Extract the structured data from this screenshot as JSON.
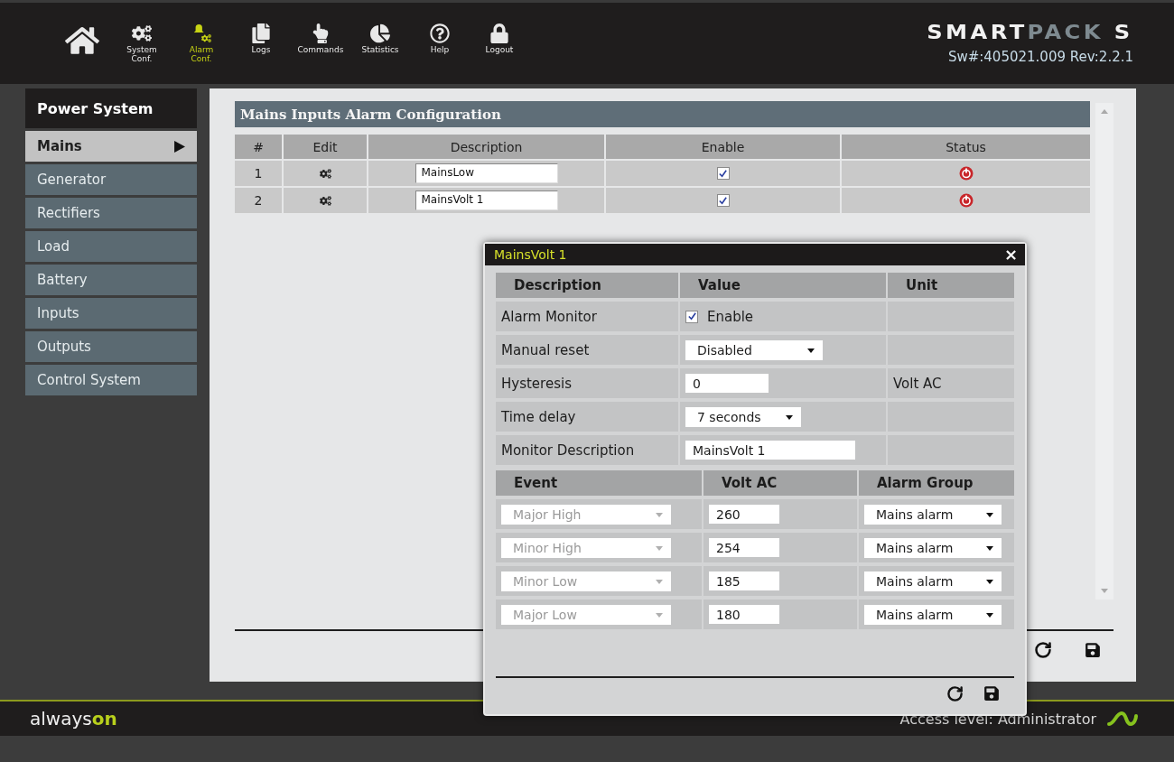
{
  "nav": {
    "items": [
      {
        "kind": "home",
        "selected": false
      },
      {
        "kind": "system",
        "label": "System\nConf.",
        "selected": false
      },
      {
        "kind": "alarm",
        "label": "Alarm\nConf.",
        "selected": true
      },
      {
        "kind": "logs",
        "label": "Logs",
        "selected": false
      },
      {
        "kind": "commands",
        "label": "Commands",
        "selected": false
      },
      {
        "kind": "statistics",
        "label": "Statistics",
        "selected": false
      },
      {
        "kind": "help",
        "label": "Help",
        "selected": false
      },
      {
        "kind": "logout",
        "label": "Logout",
        "selected": false
      }
    ]
  },
  "brand": {
    "logo": [
      {
        "text": "SMART",
        "dim": false
      },
      {
        "text": "PACK",
        "dim": true
      },
      {
        "text": " S",
        "dim": false
      }
    ],
    "version": "Sw#:405021.009 Rev:2.2.1"
  },
  "sidebar": {
    "title": "Power System",
    "items": [
      {
        "label": "Mains",
        "selected": true
      },
      {
        "label": "Generator",
        "selected": false
      },
      {
        "label": "Rectifiers",
        "selected": false
      },
      {
        "label": "Load",
        "selected": false
      },
      {
        "label": "Battery",
        "selected": false
      },
      {
        "label": "Inputs",
        "selected": false
      },
      {
        "label": "Outputs",
        "selected": false
      },
      {
        "label": "Control System",
        "selected": false
      }
    ]
  },
  "panel": {
    "title": "Mains Inputs Alarm Configuration",
    "columns": [
      "#",
      "Edit",
      "Description",
      "Enable",
      "Status"
    ],
    "rows": [
      {
        "index": "1",
        "description": "MainsLow",
        "enabled": true,
        "alarm": true
      },
      {
        "index": "2",
        "description": "MainsVolt 1",
        "enabled": true,
        "alarm": true
      }
    ]
  },
  "dialog": {
    "title": "MainsVolt 1",
    "close": "×",
    "columns": [
      "Description",
      "Value",
      "Unit"
    ],
    "rows": [
      {
        "label": "Alarm Monitor",
        "kind": "checkbox",
        "checked": true,
        "value": "Enable"
      },
      {
        "label": "Manual reset",
        "kind": "select",
        "value": "Disabled"
      },
      {
        "label": "Hysteresis",
        "kind": "input",
        "value": "0",
        "unit": "Volt AC"
      },
      {
        "label": "Time delay",
        "kind": "select",
        "value": "7 seconds"
      },
      {
        "label": "Monitor Description",
        "kind": "input",
        "value": "MainsVolt 1"
      }
    ],
    "event_columns": [
      "Event",
      "Volt AC",
      "Alarm Group"
    ],
    "events": [
      {
        "event": "Major High",
        "disabled": true,
        "volt": "260",
        "group": "Mains alarm"
      },
      {
        "event": "Minor High",
        "disabled": true,
        "volt": "254",
        "group": "Mains alarm"
      },
      {
        "event": "Minor Low",
        "disabled": true,
        "volt": "185",
        "group": "Mains alarm"
      },
      {
        "event": "Major Low",
        "disabled": true,
        "volt": "180",
        "group": "Mains alarm"
      }
    ]
  },
  "footer": {
    "brand": "always**on**",
    "access": "Access level: Administrator"
  }
}
